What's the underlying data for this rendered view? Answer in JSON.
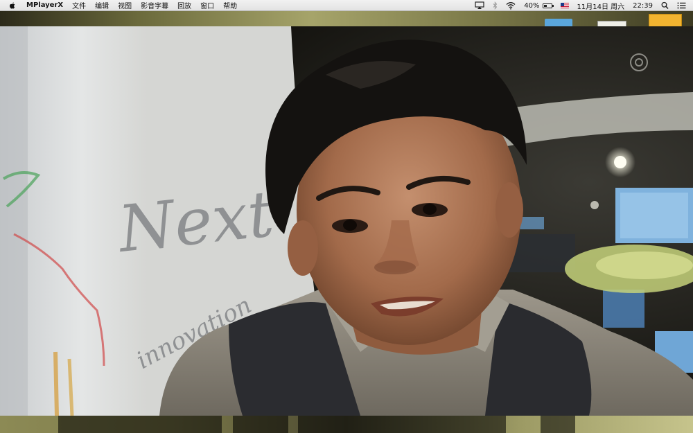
{
  "menubar": {
    "app_name": "MPlayerX",
    "items": [
      "文件",
      "编辑",
      "视图",
      "影音字幕",
      "回放",
      "窗口",
      "帮助"
    ],
    "battery_percent_label": "40%",
    "battery_level": 0.4,
    "date": "11月14日 周六",
    "time": "22:39"
  },
  "icons": {
    "apple": "apple-icon",
    "airplay": "airplay-icon",
    "bluetooth": "bluetooth-icon",
    "wifi": "wifi-icon",
    "battery": "battery-icon",
    "input_source": "us-flag-icon",
    "search": "spotlight-search-icon",
    "notifications": "notification-center-icon"
  },
  "video": {
    "wall_text": [
      "Next",
      "innovation"
    ]
  }
}
